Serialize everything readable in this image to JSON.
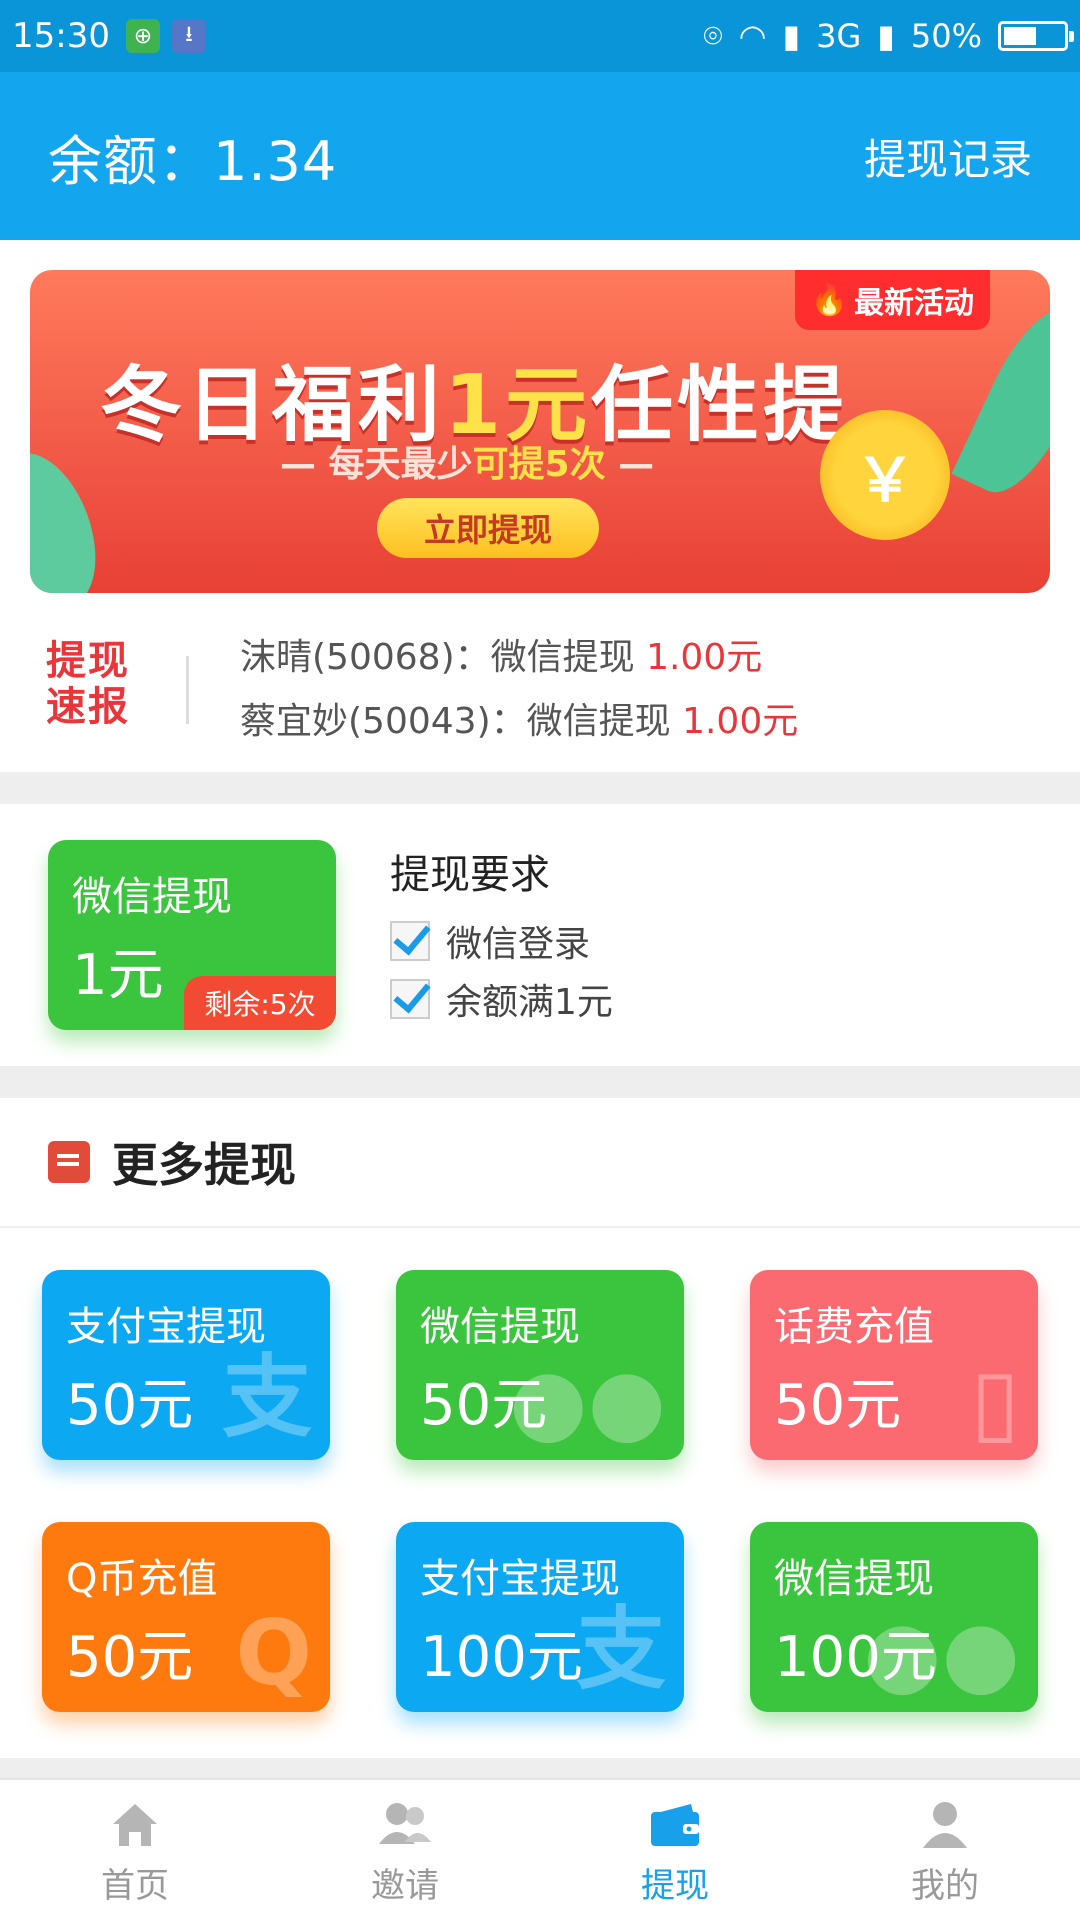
{
  "status": {
    "time": "15:30",
    "network": "3G",
    "battery": "50%",
    "battery_level": 0.5
  },
  "header": {
    "balance": "余额：1.34",
    "record_link": "提现记录"
  },
  "banner": {
    "title_pre": "冬日福利",
    "title_hl": "1元",
    "title_post": "任性提",
    "sub_pre": "— 每天最少",
    "sub_hl": "可提5次",
    "sub_post": " —",
    "cta": "立即提现",
    "tag": "最新活动",
    "coin": "￥"
  },
  "news": {
    "logo_line1": "提现",
    "logo_line2": "速报",
    "items": [
      {
        "text": "沫晴(50068)：微信提现 ",
        "amount": "1.00元"
      },
      {
        "text": "蔡宜妙(50043)：微信提现 ",
        "amount": "1.00元"
      }
    ]
  },
  "featured": {
    "title": "微信提现",
    "value": "1元",
    "remain": "剩余:5次",
    "req_title": "提现要求",
    "req_items": [
      "微信登录",
      "余额满1元"
    ]
  },
  "more": {
    "title": "更多提现",
    "tiles": [
      {
        "title": "支付宝提现",
        "value": "50元",
        "color": "#0ca8f2"
      },
      {
        "title": "微信提现",
        "value": "50元",
        "color": "#3bc43d"
      },
      {
        "title": "话费充值",
        "value": "50元",
        "color": "#fb6a70"
      },
      {
        "title": "Q币充值",
        "value": "50元",
        "color": "#ff7a0e"
      },
      {
        "title": "支付宝提现",
        "value": "100元",
        "color": "#0ca8f2"
      },
      {
        "title": "微信提现",
        "value": "100元",
        "color": "#3bc43d"
      }
    ]
  },
  "tabs": [
    {
      "label": "首页",
      "icon": "home-icon"
    },
    {
      "label": "邀请",
      "icon": "invite-icon"
    },
    {
      "label": "提现",
      "icon": "wallet-icon",
      "active": true
    },
    {
      "label": "我的",
      "icon": "user-icon"
    }
  ]
}
